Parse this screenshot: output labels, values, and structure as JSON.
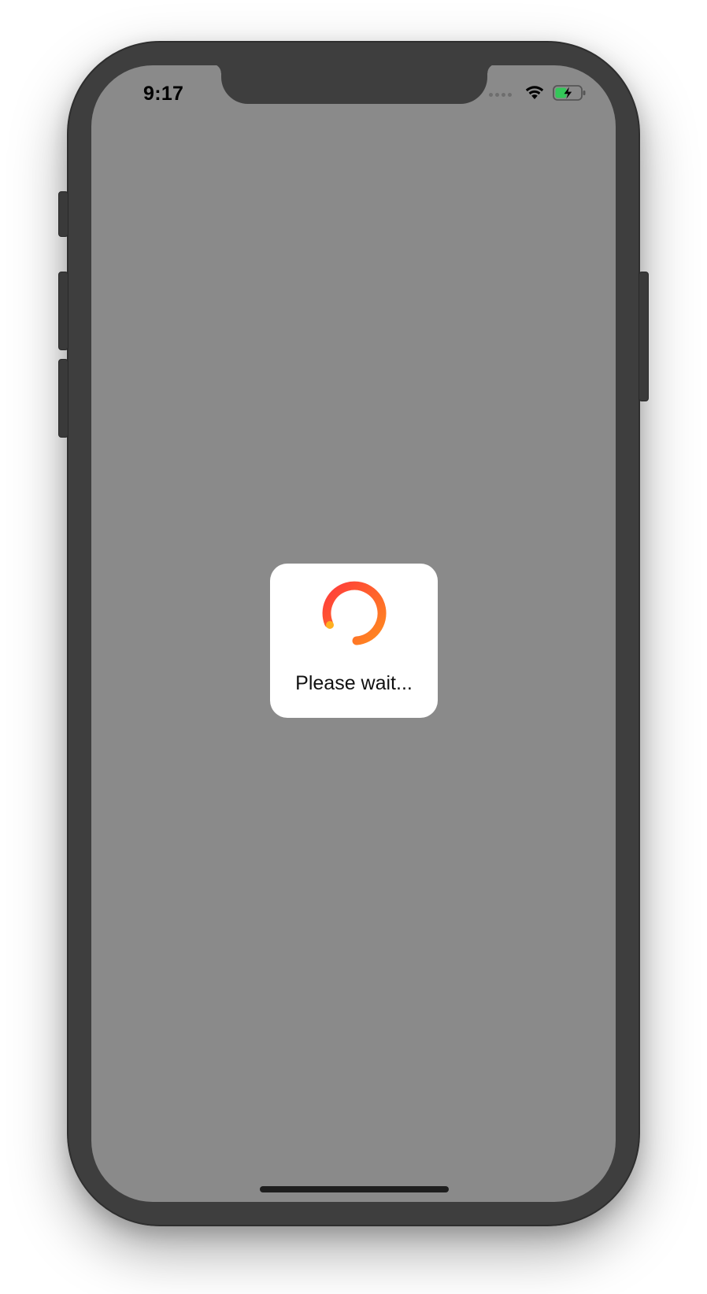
{
  "status_bar": {
    "time": "9:17",
    "icons": [
      "signal-dots-icon",
      "wifi-icon",
      "battery-charging-icon"
    ]
  },
  "loading_hud": {
    "message": "Please wait...",
    "spinner_colors": [
      "#ff3b3b",
      "#ff8a1f"
    ]
  },
  "colors": {
    "screen_background": "#8a8a8a",
    "hud_background": "#ffffff",
    "battery_fill": "#34c759"
  }
}
